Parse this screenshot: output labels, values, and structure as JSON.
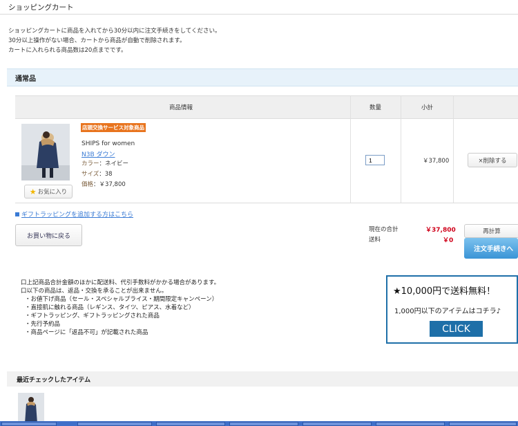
{
  "page": {
    "title": "ショッピングカート",
    "notice": [
      "ショッピングカートに商品を入れてから30分以内に注文手続きをしてください。",
      "30分以上操作がない場合、カートから商品が自動で削除されます。",
      "カートに入れられる商品数は20点までです。"
    ]
  },
  "section": {
    "title": "通常品"
  },
  "table": {
    "headers": {
      "info": "商品情報",
      "qty": "数量",
      "subtotal": "小計"
    }
  },
  "item": {
    "badge": "店頭交換サービス対象商品",
    "brand": "SHIPS for women",
    "name": "N3B ダウン",
    "color_label": "カラー",
    "color_value": "ネイビー",
    "size_label": "サイズ",
    "size_value": "38",
    "price_label": "価格",
    "price_value": "￥37,800",
    "quantity": "1",
    "subtotal": "￥37,800",
    "favorite_label": "お気に入り",
    "delete_label": "×削除する"
  },
  "cart": {
    "gift_link": "ギフトラッピングを追加する方はこちら",
    "continue_label": "お買い物に戻る",
    "total_label": "現在の合計",
    "total_value": "￥37,800",
    "shipping_label": "送料",
    "shipping_value": "￥0",
    "recalc_label": "再計算",
    "checkout_label": "注文手続きへ"
  },
  "notes": [
    "口上記商品合計金額のほかに配送料、代引手数料がかかる場合があります。",
    "口以下の商品は、返品・交換を承ることが出来ません。",
    "・お値下げ商品（セール・スペシャルプライス・期間限定キャンペーン）",
    "・直接肌に触れる商品（レギンス、タイツ、ピアス、水着など）",
    "・ギフトラッピング、ギフトラッピングされた商品",
    "・先行予約品",
    "・商品ページに「返品不可」が記載された商品"
  ],
  "promo": {
    "title": "★10,000円で送料無料！",
    "subtitle": "1,000円以下のアイテムはコチラ♪",
    "button": "CLICK"
  },
  "recent": {
    "title": "最近チェックしたアイテム"
  },
  "colors": {
    "accent": "#3a94d6",
    "price_red": "#d0021b",
    "badge": "#e8741e",
    "promo_blue": "#1e6fa8"
  }
}
